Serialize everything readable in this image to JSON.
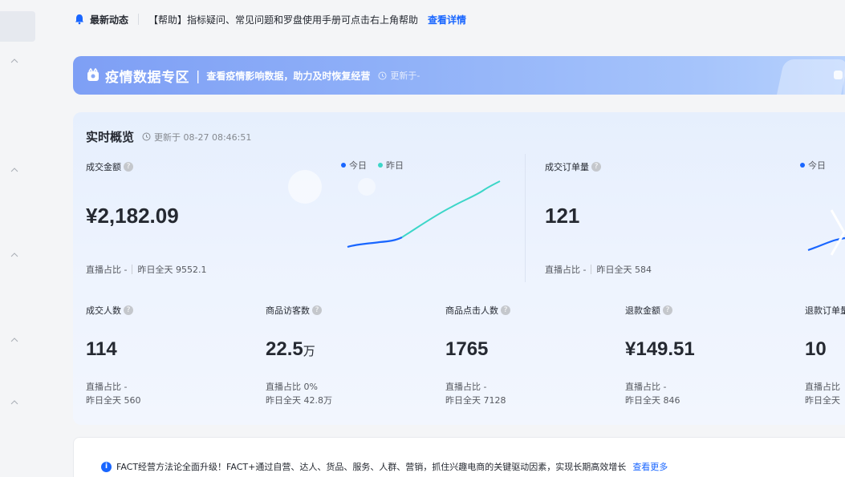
{
  "notice": {
    "title": "最新动态",
    "message": "【帮助】指标疑问、常见问题和罗盘使用手册可点击右上角帮助",
    "link": "查看详情"
  },
  "banner": {
    "title": "疫情数据专区",
    "separator": "|",
    "description": "查看疫情影响数据，助力及时恢复经营",
    "updated": "更新于-"
  },
  "realtime": {
    "title": "实时概览",
    "updated": "更新于 08-27 08:46:51",
    "legend_today": "今日",
    "legend_yesterday": "昨日",
    "colors": {
      "today": "#1966ff",
      "yesterday": "#3cd6c8"
    },
    "gmv": {
      "label": "成交金额",
      "value": "¥2,182.09",
      "live_ratio": "直播占比 -",
      "yesterday_total": "昨日全天 9552.1"
    },
    "orders": {
      "label": "成交订单量",
      "value": "121",
      "live_ratio": "直播占比 -",
      "yesterday_total": "昨日全天 584"
    },
    "metrics": [
      {
        "label": "成交人数",
        "value": "114",
        "unit": "",
        "line1": "直播占比 -",
        "line2": "昨日全天 560"
      },
      {
        "label": "商品访客数",
        "value": "22.5",
        "unit": "万",
        "line1": "直播占比 0%",
        "line2": "昨日全天 42.8万"
      },
      {
        "label": "商品点击人数",
        "value": "1765",
        "unit": "",
        "line1": "直播占比 -",
        "line2": "昨日全天 7128"
      },
      {
        "label": "退款金额",
        "value": "¥149.51",
        "unit": "",
        "line1": "直播占比 -",
        "line2": "昨日全天 846"
      },
      {
        "label": "退款订单量",
        "value": "10",
        "unit": "",
        "line1": "直播占比",
        "line2": "昨日全天"
      }
    ]
  },
  "tip": {
    "message": "FACT经营方法论全面升级！FACT+通过自营、达人、货品、服务、人群、营销，抓住兴趣电商的关键驱动因素，实现长期高效增长",
    "link": "查看更多"
  }
}
